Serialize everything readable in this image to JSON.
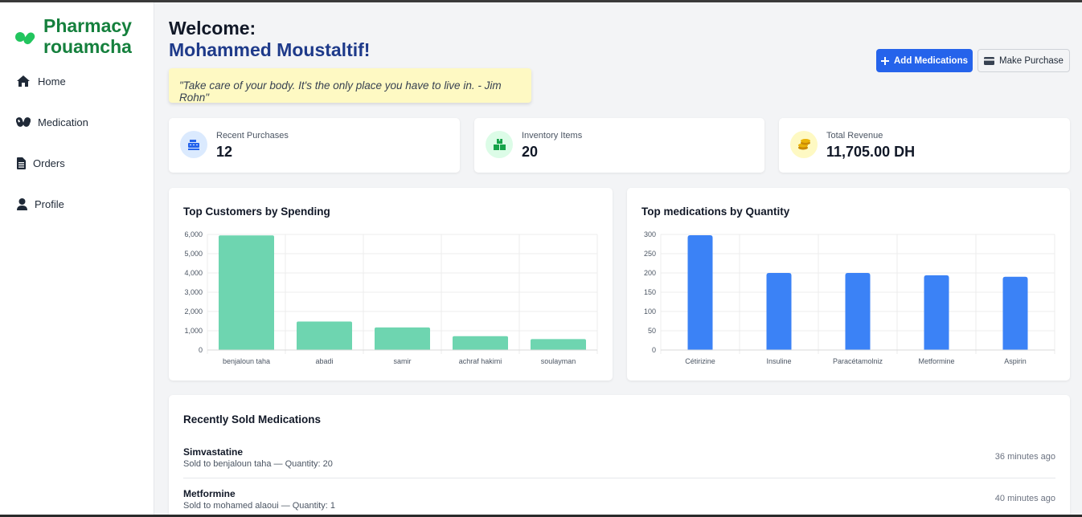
{
  "brand": {
    "name_line1": "Pharmacy",
    "name_line2": "rouamcha",
    "logo_icon": "pill-icon",
    "color": "#15803d"
  },
  "sidebar": {
    "items": [
      {
        "label": "Home",
        "icon": "home-icon"
      },
      {
        "label": "Medication",
        "icon": "pills-icon"
      },
      {
        "label": "Orders",
        "icon": "document-icon"
      },
      {
        "label": "Profile",
        "icon": "user-icon"
      }
    ]
  },
  "header": {
    "welcome": "Welcome:",
    "user_name": "Mohammed Moustaltif!",
    "quote": "\"Take care of your body. It's the only place you have to live in. - Jim Rohn\"",
    "add_button": "Add Medications",
    "purchase_button": "Make Purchase"
  },
  "stats": [
    {
      "label": "Recent Purchases",
      "value": "12",
      "icon": "cash-register-icon",
      "icon_bg": "#dbeafe",
      "icon_color": "#2563eb"
    },
    {
      "label": "Inventory Items",
      "value": "20",
      "icon": "boxes-icon",
      "icon_bg": "#dcfce7",
      "icon_color": "#16a34a"
    },
    {
      "label": "Total Revenue",
      "value": "11,705.00 DH",
      "icon": "coins-icon",
      "icon_bg": "#fef9c3",
      "icon_color": "#ca8a04"
    }
  ],
  "chart_data": [
    {
      "type": "bar",
      "title": "Top Customers by Spending",
      "categories": [
        "benjaloun taha",
        "abadi",
        "samir",
        "achraf hakimi",
        "soulayman"
      ],
      "values": [
        5950,
        1480,
        1170,
        720,
        570
      ],
      "ylim": [
        0,
        6000
      ],
      "yticks": [
        "0",
        "1,000",
        "2,000",
        "3,000",
        "4,000",
        "5,000",
        "6,000"
      ],
      "color": "#6ed5b0",
      "grid": true
    },
    {
      "type": "bar",
      "title": "Top medications by Quantity",
      "categories": [
        "Cétirizine",
        "Insuline",
        "Paracétamolniz",
        "Metformine",
        "Aspirin"
      ],
      "values": [
        298,
        200,
        200,
        194,
        190
      ],
      "ylim": [
        0,
        300
      ],
      "yticks": [
        "0",
        "50",
        "100",
        "150",
        "200",
        "250",
        "300"
      ],
      "color": "#3b82f6",
      "grid": true
    }
  ],
  "recent": {
    "title": "Recently Sold Medications",
    "items": [
      {
        "name": "Simvastatine",
        "detail": "Sold to benjaloun taha — Quantity: 20",
        "time": "36 minutes ago"
      },
      {
        "name": "Metformine",
        "detail": "Sold to mohamed alaoui — Quantity: 1",
        "time": "40 minutes ago"
      }
    ]
  }
}
